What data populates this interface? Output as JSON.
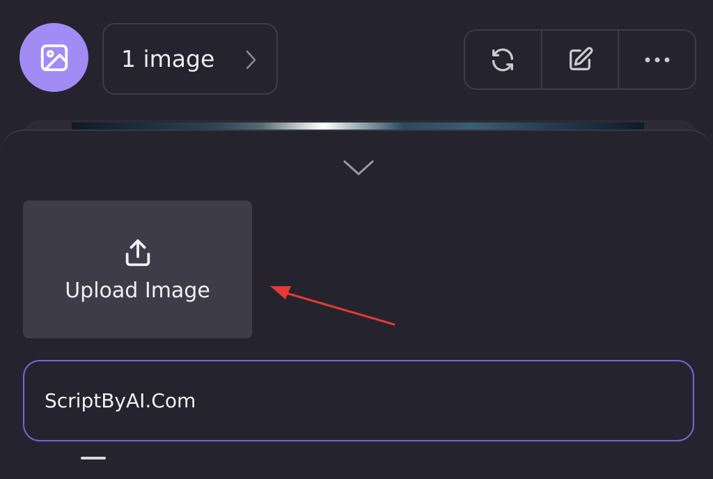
{
  "header": {
    "avatar_icon": "image-icon",
    "image_count_label": "1 image",
    "toolbar": {
      "icons": [
        "refresh-icon",
        "edit-icon",
        "more-icon"
      ]
    }
  },
  "sheet": {
    "collapse_icon": "chevron-down-icon",
    "upload": {
      "icon": "upload-icon",
      "label": "Upload Image"
    },
    "prompt": {
      "value": "ScriptByAI.Com"
    }
  },
  "colors": {
    "accent": "#a18cf5",
    "input_border": "#7a63d9",
    "background": "#25242e",
    "annotation_arrow": "#e53935"
  }
}
